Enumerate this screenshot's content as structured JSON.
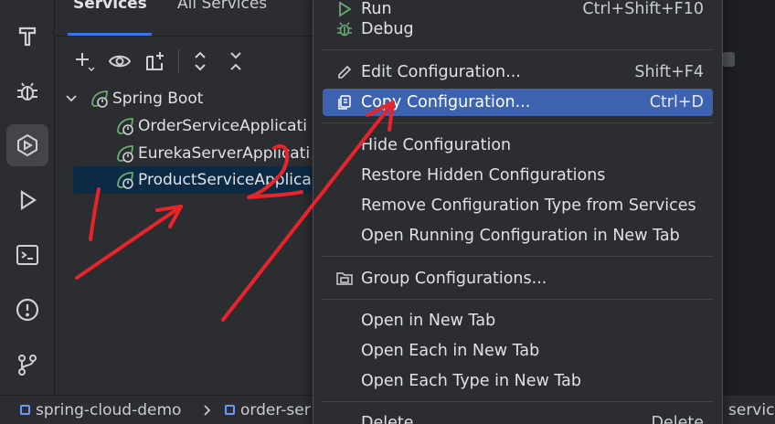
{
  "activity_bar": {
    "items": [
      {
        "icon": "build-hammer-icon"
      },
      {
        "icon": "debug-bug-icon"
      },
      {
        "icon": "services-icon"
      },
      {
        "icon": "run-icon"
      },
      {
        "icon": "terminal-icon"
      },
      {
        "icon": "problems-icon"
      },
      {
        "icon": "git-icon"
      }
    ]
  },
  "services": {
    "tabs": [
      {
        "label": "Services"
      },
      {
        "label": "All Services"
      }
    ],
    "toolbar": [
      "add-icon",
      "eye-icon",
      "new-group-icon",
      "expand-all-icon",
      "collapse-all-icon"
    ],
    "group": {
      "label": "Spring Boot"
    },
    "items": [
      {
        "label": "OrderServiceApplicati"
      },
      {
        "label": "EurekaServerApplicati"
      },
      {
        "label": "ProductServiceApplica"
      }
    ]
  },
  "breadcrumb": {
    "items": [
      {
        "label": "spring-cloud-demo"
      },
      {
        "label": "order-ser"
      }
    ],
    "trailing": "servic"
  },
  "menu": {
    "items": [
      {
        "label": "Run",
        "shortcut": "Ctrl+Shift+F10"
      },
      {
        "label": "Debug",
        "shortcut": ""
      },
      {
        "label": "Edit Configuration...",
        "shortcut": "Shift+F4"
      },
      {
        "label": "Copy Configuration...",
        "shortcut": "Ctrl+D"
      },
      {
        "label": "Hide Configuration",
        "shortcut": ""
      },
      {
        "label": "Restore Hidden Configurations",
        "shortcut": ""
      },
      {
        "label": "Remove Configuration Type from Services",
        "shortcut": ""
      },
      {
        "label": "Open Running Configuration in New Tab",
        "shortcut": ""
      },
      {
        "label": "Group Configurations...",
        "shortcut": ""
      },
      {
        "label": "Open in New Tab",
        "shortcut": ""
      },
      {
        "label": "Open Each in New Tab",
        "shortcut": ""
      },
      {
        "label": "Open Each Type in New Tab",
        "shortcut": ""
      },
      {
        "label": "Delete",
        "shortcut": "Delete"
      }
    ]
  },
  "annotations": {
    "marks": [
      "1",
      "2"
    ],
    "color": "#e8232a"
  },
  "colors": {
    "accent": "#3574f0",
    "highlight": "#3d63b0",
    "selection": "#0d2a44",
    "spring_green": "#6aab73"
  }
}
